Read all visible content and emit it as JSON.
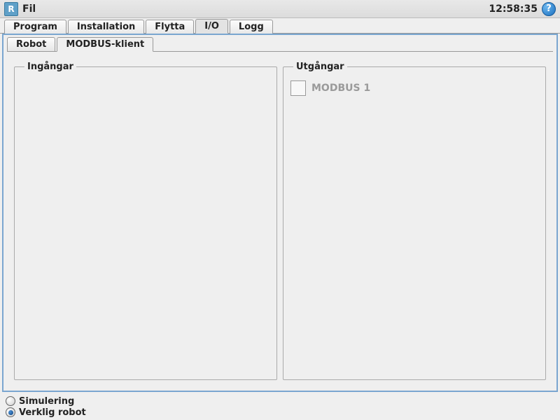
{
  "titlebar": {
    "menu_label": "Fil",
    "time": "12:58:35",
    "logo_text": "R"
  },
  "main_tabs": [
    {
      "label": "Program"
    },
    {
      "label": "Installation"
    },
    {
      "label": "Flytta"
    },
    {
      "label": "I/O"
    },
    {
      "label": "Logg"
    }
  ],
  "main_tabs_active_index": 3,
  "sub_tabs": [
    {
      "label": "Robot"
    },
    {
      "label": "MODBUS-klient"
    }
  ],
  "sub_tabs_active_index": 1,
  "panels": {
    "inputs": {
      "title": "Ingångar",
      "items": []
    },
    "outputs": {
      "title": "Utgångar",
      "items": [
        {
          "label": "MODBUS 1",
          "value": false
        }
      ]
    }
  },
  "footer": {
    "simulation_label": "Simulering",
    "real_label": "Verklig robot",
    "selected": "real"
  }
}
